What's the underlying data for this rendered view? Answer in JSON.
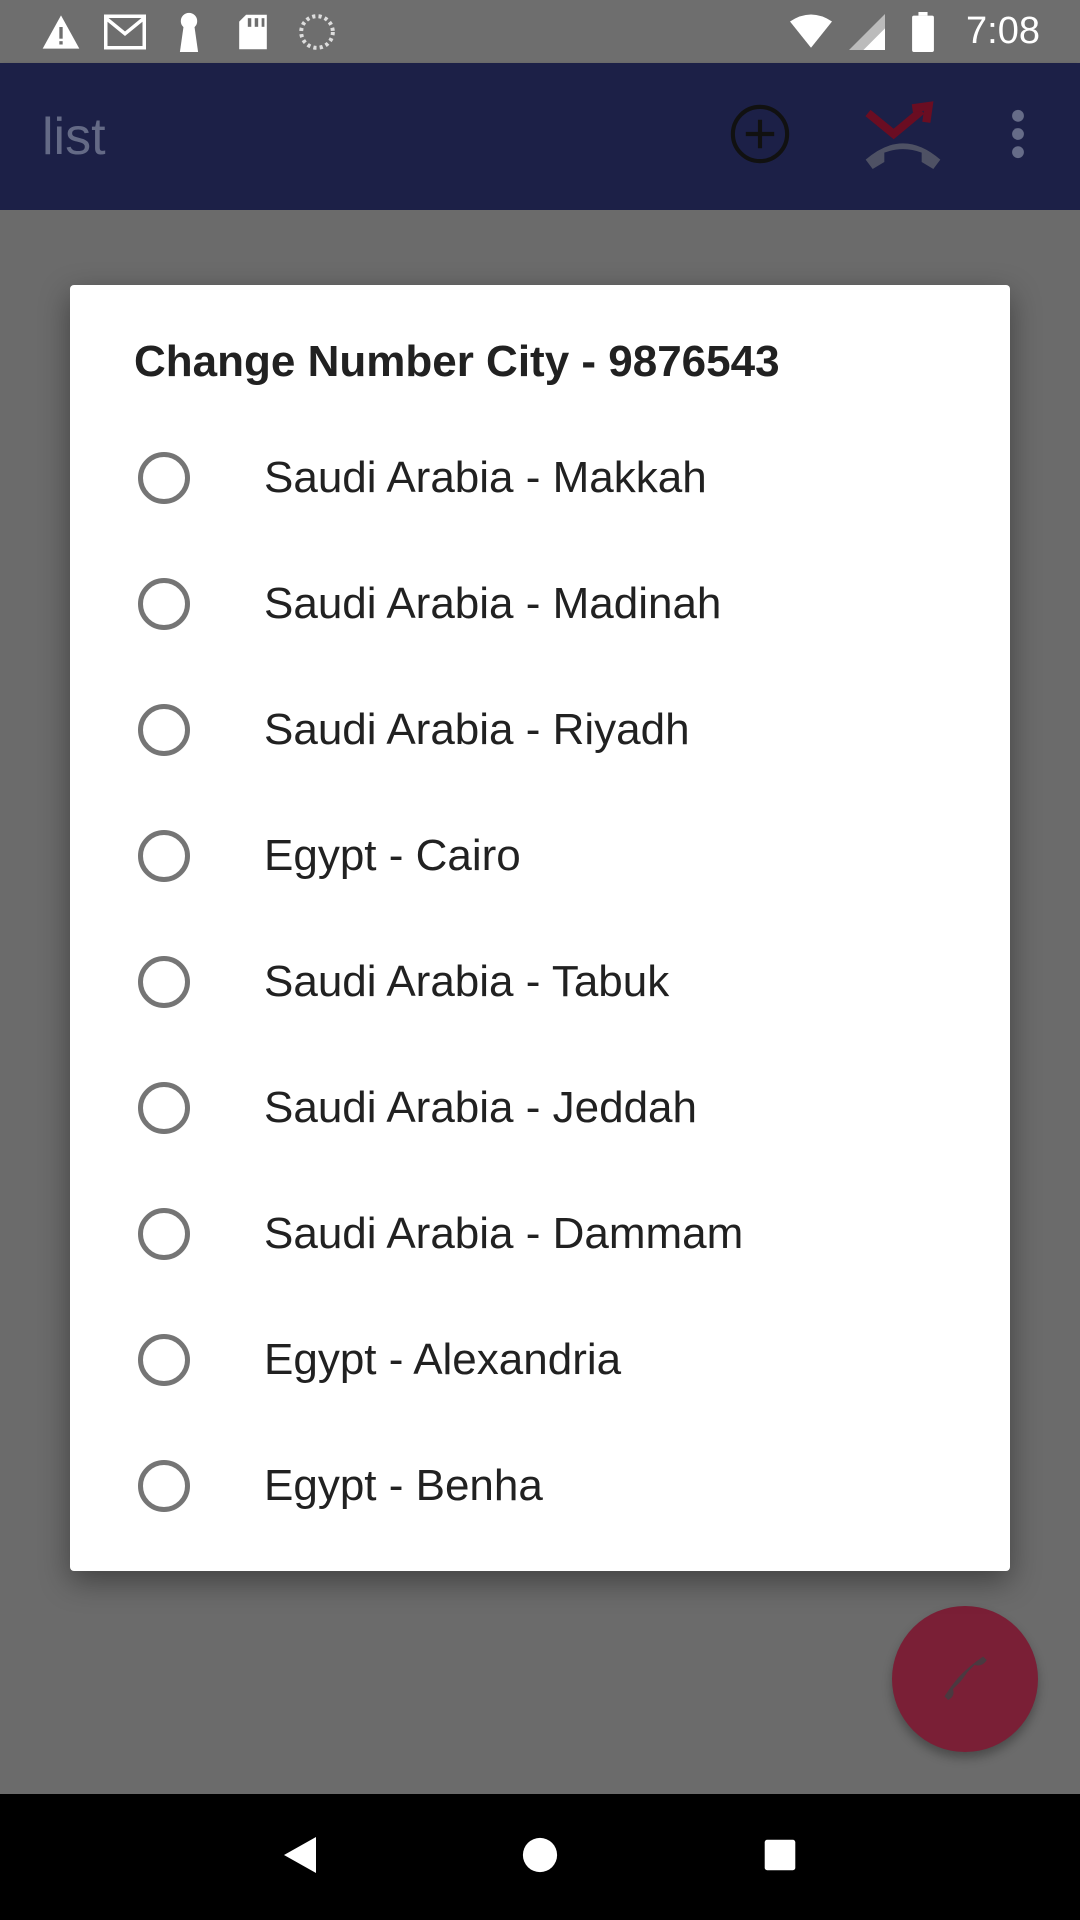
{
  "status_bar": {
    "time": "7:08",
    "left_icons": [
      "warning-icon",
      "gmail-icon",
      "keyhole-icon",
      "sd-card-icon",
      "sync-icon"
    ],
    "right_icons": [
      "wifi-icon",
      "signal-icon",
      "battery-icon"
    ]
  },
  "app_bar": {
    "title": "list",
    "actions": [
      "add-circle-icon",
      "missed-call-icon",
      "more-vert-icon"
    ]
  },
  "dialog": {
    "title": "Change Number City - 9876543",
    "options": [
      {
        "label": "Saudi Arabia - Makkah",
        "selected": false
      },
      {
        "label": "Saudi Arabia - Madinah",
        "selected": false
      },
      {
        "label": "Saudi Arabia - Riyadh",
        "selected": false
      },
      {
        "label": "Egypt - Cairo",
        "selected": false
      },
      {
        "label": "Saudi Arabia - Tabuk",
        "selected": false
      },
      {
        "label": "Saudi Arabia - Jeddah",
        "selected": false
      },
      {
        "label": "Saudi Arabia - Dammam",
        "selected": false
      },
      {
        "label": "Egypt - Alexandria",
        "selected": false
      },
      {
        "label": "Egypt - Benha",
        "selected": false
      }
    ]
  },
  "fab": {
    "icon": "phone-icon"
  },
  "nav_bar": {
    "buttons": [
      "back-icon",
      "home-icon",
      "recents-icon"
    ]
  },
  "colors": {
    "app_bar": "#1c2047",
    "fab": "#7a1f36",
    "accent_call": "#b0123c"
  }
}
